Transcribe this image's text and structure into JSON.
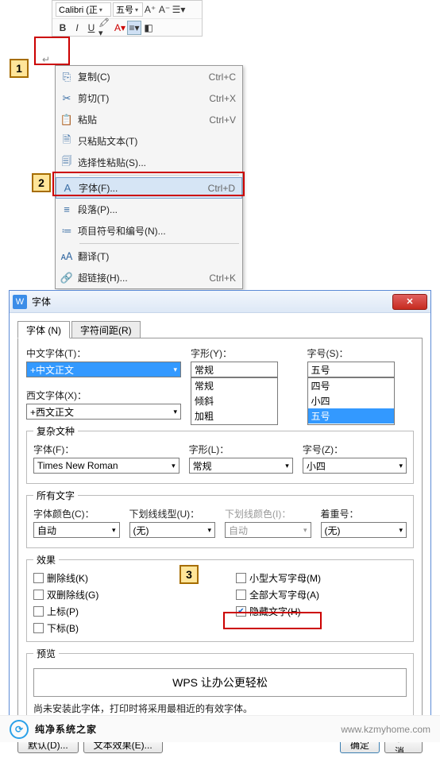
{
  "toolbar": {
    "font_name": "Calibri (正",
    "font_size": "五号",
    "grow": "A⁺",
    "shrink": "A⁻"
  },
  "marker1": "1",
  "marker2": "2",
  "marker3": "3",
  "ctx": {
    "items": [
      {
        "icon": "⎘",
        "label": "复制(C)",
        "shortcut": "Ctrl+C"
      },
      {
        "icon": "✂",
        "label": "剪切(T)",
        "shortcut": "Ctrl+X"
      },
      {
        "icon": "📋",
        "label": "粘贴",
        "shortcut": "Ctrl+V"
      },
      {
        "icon": "🗎",
        "label": "只粘贴文本(T)",
        "shortcut": ""
      },
      {
        "icon": "🗐",
        "label": "选择性粘贴(S)...",
        "shortcut": ""
      }
    ],
    "font_item": {
      "icon": "A",
      "label": "字体(F)...",
      "shortcut": "Ctrl+D"
    },
    "items2": [
      {
        "icon": "≡",
        "label": "段落(P)...",
        "shortcut": ""
      },
      {
        "icon": "≔",
        "label": "项目符号和编号(N)...",
        "shortcut": ""
      }
    ],
    "items3": [
      {
        "icon": "🗚",
        "label": "翻译(T)",
        "shortcut": ""
      },
      {
        "icon": "🔗",
        "label": "超链接(H)...",
        "shortcut": "Ctrl+K"
      }
    ]
  },
  "dlg": {
    "title": "字体",
    "tabs": {
      "font": "字体 (N)",
      "spacing": "字符间距(R)"
    },
    "cn_font_label": "中文字体(T)：",
    "cn_font_value": "+中文正文",
    "style_label": "字形(Y)：",
    "style_value": "常规",
    "style_list": [
      "常规",
      "倾斜",
      "加粗"
    ],
    "size_label": "字号(S)：",
    "size_value": "五号",
    "size_list": [
      "四号",
      "小四",
      "五号"
    ],
    "en_font_label": "西文字体(X)：",
    "en_font_value": "+西文正文",
    "complex_legend": "复杂文种",
    "cx_font_label": "字体(F)：",
    "cx_font_value": "Times New Roman",
    "cx_style_label": "字形(L)：",
    "cx_style_value": "常规",
    "cx_size_label": "字号(Z)：",
    "cx_size_value": "小四",
    "all_legend": "所有文字",
    "color_label": "字体颜色(C)：",
    "color_value": "自动",
    "ul_label": "下划线线型(U)：",
    "ul_value": "(无)",
    "ul_color_label": "下划线颜色(I)：",
    "ul_color_value": "自动",
    "emph_label": "着重号：",
    "emph_value": "(无)",
    "fx_legend": "效果",
    "fx": {
      "strike": "删除线(K)",
      "dblstrike": "双删除线(G)",
      "super": "上标(P)",
      "sub": "下标(B)",
      "smallcaps": "小型大写字母(M)",
      "allcaps": "全部大写字母(A)",
      "hidden": "隐藏文字(H)"
    },
    "preview_legend": "预览",
    "preview_text": "WPS 让办公更轻松",
    "note": "尚未安装此字体，打印时将采用最相近的有效字体。",
    "btn_default": "默认(D)...",
    "btn_texteffect": "文本效果(E)...",
    "btn_ok": "确定",
    "btn_cancel": "取消"
  },
  "wm": {
    "brand": "纯净系统之家",
    "url": "www.kzmyhome.com"
  }
}
